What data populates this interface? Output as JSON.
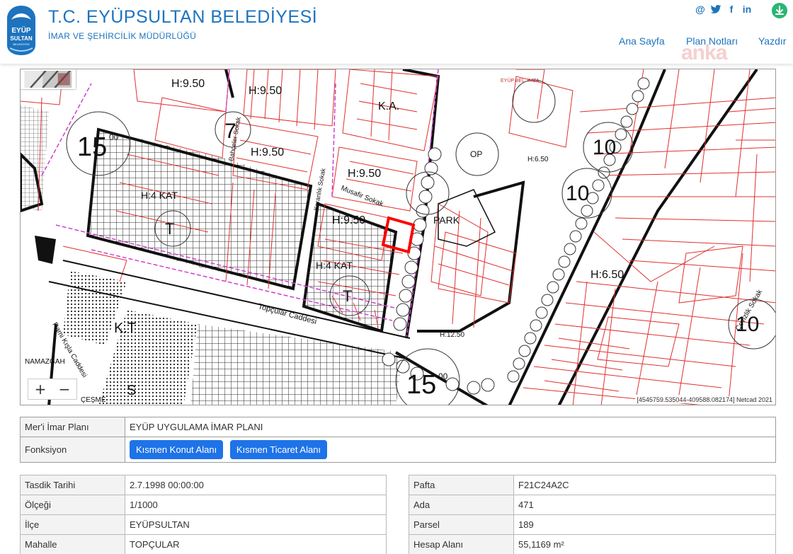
{
  "header": {
    "title": "T.C. EYÜPSULTAN BELEDİYESİ",
    "subtitle": "İMAR VE ŞEHİRCİLİK MÜDÜRLÜĞÜ",
    "logo_text_top": "EYÜP",
    "logo_text_bottom": "SULTAN",
    "logo_text_small": "BELEDİYESİ",
    "social": {
      "email": "@",
      "twitter": "twitter-icon",
      "facebook": "f",
      "linkedin": "in"
    },
    "nav": [
      "Ana Sayfa",
      "Plan Notları",
      "Yazdır"
    ],
    "watermark": "anka"
  },
  "map": {
    "coordinates": "[4545759.535044-409588.082174] Netcad 2021",
    "zoom_in": "+",
    "zoom_out": "−",
    "labels": {
      "h950_a": "H:9.50",
      "h950_b": "H:9.50",
      "h950_c": "H:9.50",
      "h950_d": "H:9.50",
      "h950_e": "H:9.50",
      "h650_a": "H:6.50",
      "h650_b": "H:6.50",
      "h1250": "H:12.50",
      "ka": "K.A.",
      "kt": "K.T",
      "park": "PARK",
      "op": "OP",
      "kat4_a": "H:4 KAT",
      "kat4_b": "H:4 KAT",
      "t_a": "T",
      "t_b": "T",
      "s": "S",
      "num15_a": "15",
      "num15_b": "15",
      "num10_a": "10",
      "num10_b": "10",
      "num10_c": "10",
      "num7": "7",
      "sup00": "00",
      "street_topcular": "Topçular Caddesi",
      "street_musafir": "Musafir Sokak",
      "street_karanlik": "Karanlık Sokak",
      "street_bahceler": "Bahçeler Sokak",
      "street_ramikisla": "Rami Kışla Caddesi",
      "street_namazgah": "NAMAZGAH",
      "street_cesme": "ÇEŞME",
      "street_cevizlik": "Cevizlik Sokak",
      "eyup_bel": "EYÜP BEL. İMZA"
    },
    "colors": {
      "parcel": "#e03030",
      "road_pink": "#d040d0",
      "black": "#111111",
      "selection": "#ff0000"
    }
  },
  "plan": {
    "plan_label": "Mer'i İmar Planı",
    "plan_value": "EYÜP UYGULAMA İMAR PLANI",
    "function_label": "Fonksiyon",
    "functions": [
      "Kısmen Konut Alanı",
      "Kısmen Ticaret Alanı"
    ]
  },
  "details_left": [
    {
      "label": "Tasdik Tarihi",
      "value": "2.7.1998 00:00:00"
    },
    {
      "label": "Ölçeği",
      "value": "1/1000"
    },
    {
      "label": "İlçe",
      "value": "EYÜPSULTAN"
    },
    {
      "label": "Mahalle",
      "value": "TOPÇULAR"
    }
  ],
  "details_right": [
    {
      "label": "Pafta",
      "value": "F21C24A2C"
    },
    {
      "label": "Ada",
      "value": "471"
    },
    {
      "label": "Parsel",
      "value": "189"
    },
    {
      "label": "Hesap Alanı",
      "value": "55,1169 m²"
    }
  ]
}
